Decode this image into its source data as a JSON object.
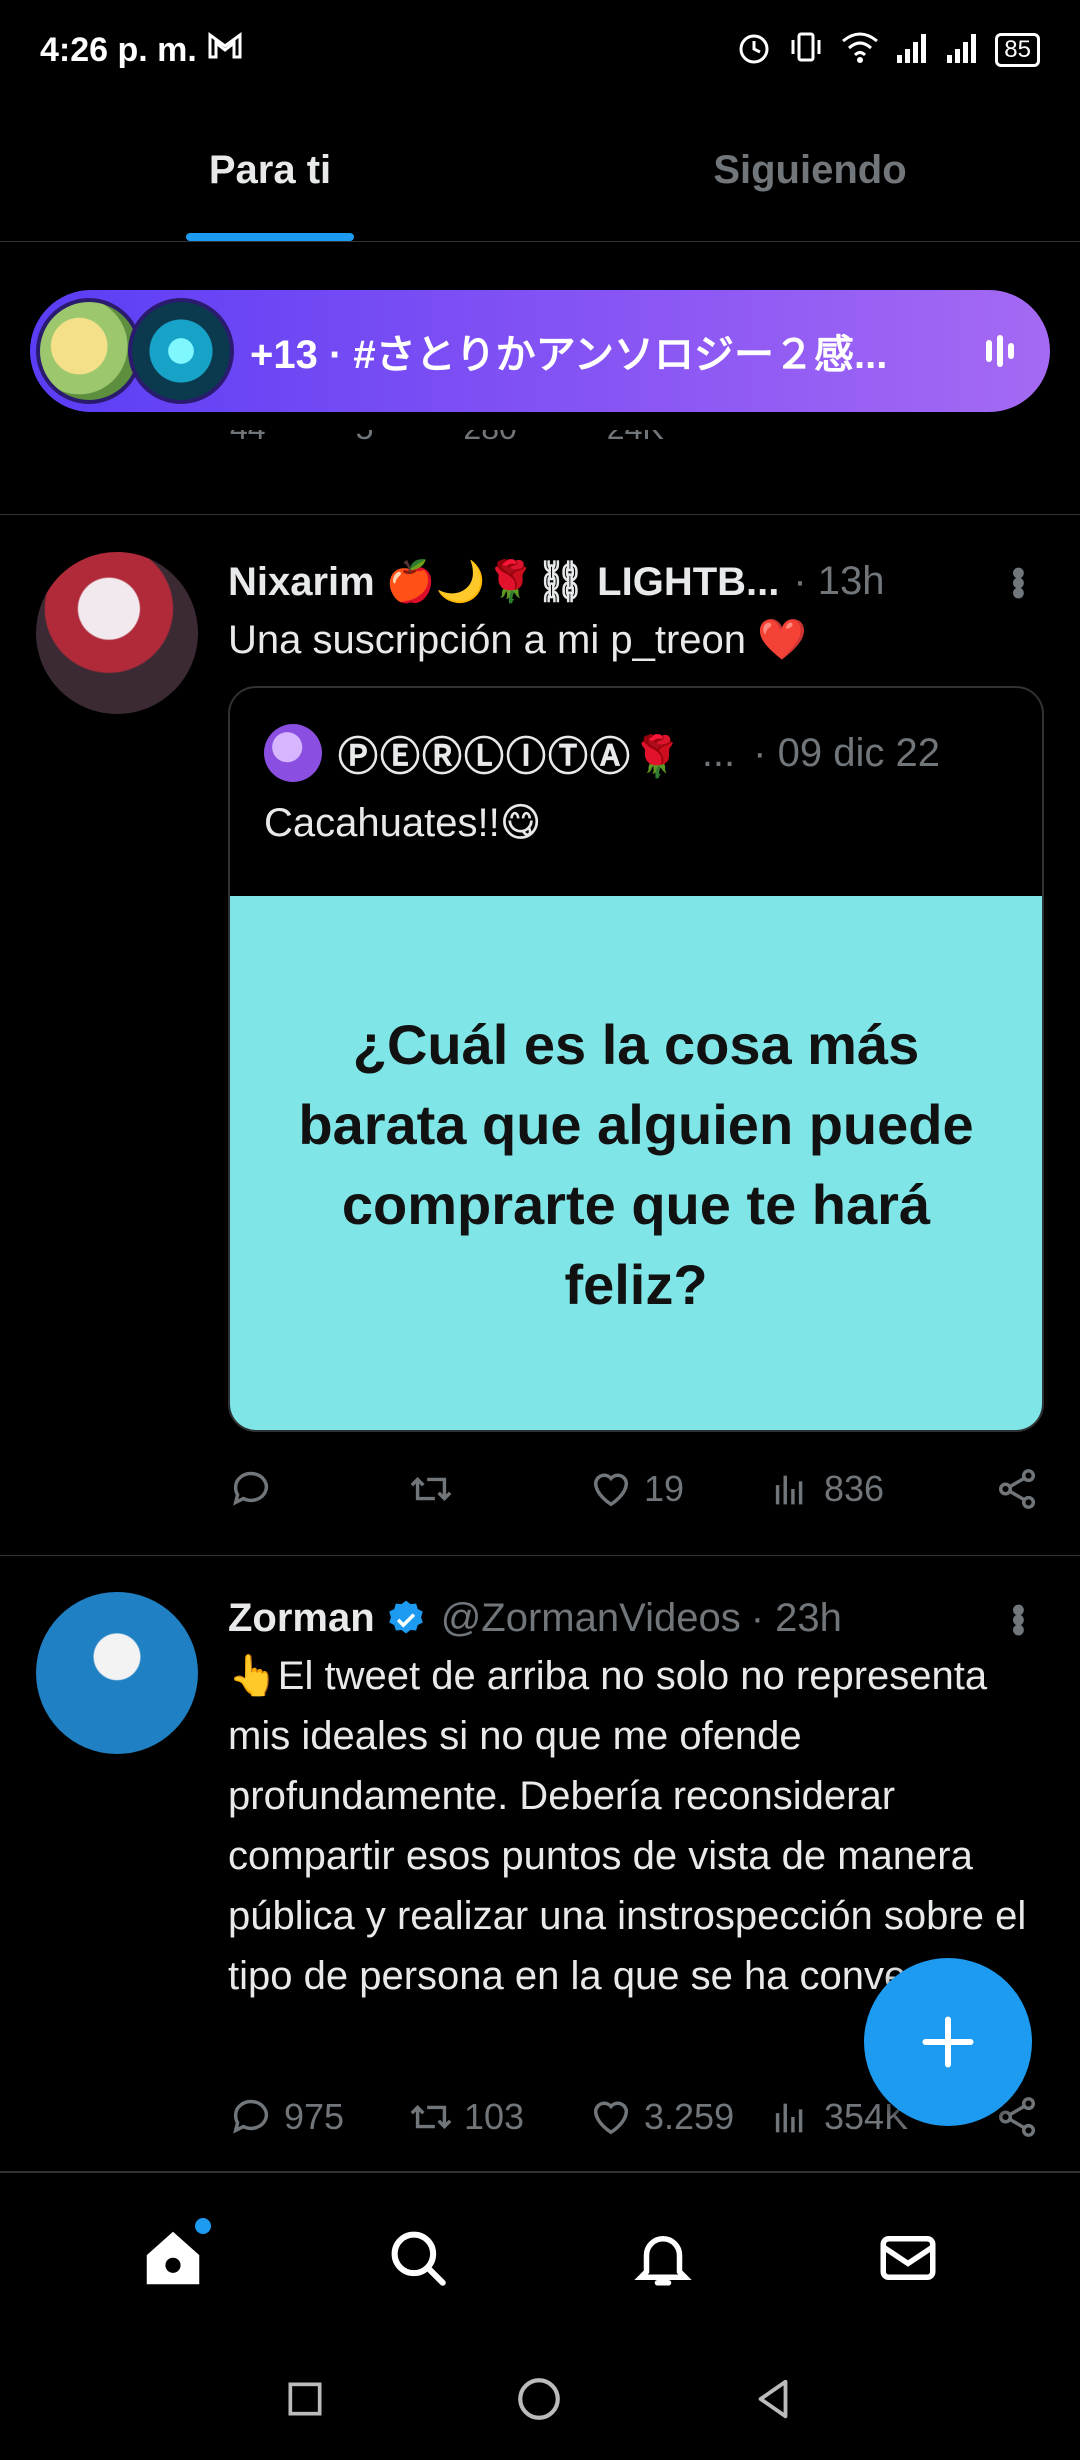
{
  "status_bar": {
    "time": "4:26 p. m.",
    "mail_icon": "gmail-icon",
    "battery": "85"
  },
  "tabs": [
    {
      "label": "Para ti",
      "active": true
    },
    {
      "label": "Siguiendo",
      "active": false
    }
  ],
  "space": {
    "text": "+13 · #さとりかアンソロジー２感..."
  },
  "partial_tweet": {
    "replies": "44",
    "retweets": "5",
    "likes": "280",
    "views": "24K"
  },
  "tweet1": {
    "name": "Nixarim 🍎🌙🌹⛓ LIGHTB...",
    "time": "· 13h",
    "text": "Una suscripción a mi p_treon ❤️",
    "quote": {
      "name": "ⓅⒺⓇⓁⒾⓉⒶ🌹",
      "ellipsis": "...",
      "date": "· 09 dic 22",
      "text": "Cacahuates!!😋",
      "image_text": "¿Cuál es la cosa más barata que alguien puede comprarte que te hará feliz?"
    },
    "replies": "",
    "retweets": "",
    "likes": "19",
    "views": "836"
  },
  "tweet2": {
    "name": "Zorman",
    "handle": "@ZormanVideos",
    "time": "· 23h",
    "text": "👆El tweet de arriba no solo no representa mis ideales si no que me ofende profundamente. Debería reconsiderar compartir esos puntos de vista de manera pública y realizar una instrospección sobre el tipo de persona en la que se ha convertido.",
    "replies": "975",
    "retweets": "103",
    "likes": "3.259",
    "views": "354K"
  },
  "colors": {
    "accent": "#1d9bf0",
    "background": "#000000",
    "secondary_text": "#71767b",
    "quote_image_bg": "#7fe5e6"
  }
}
